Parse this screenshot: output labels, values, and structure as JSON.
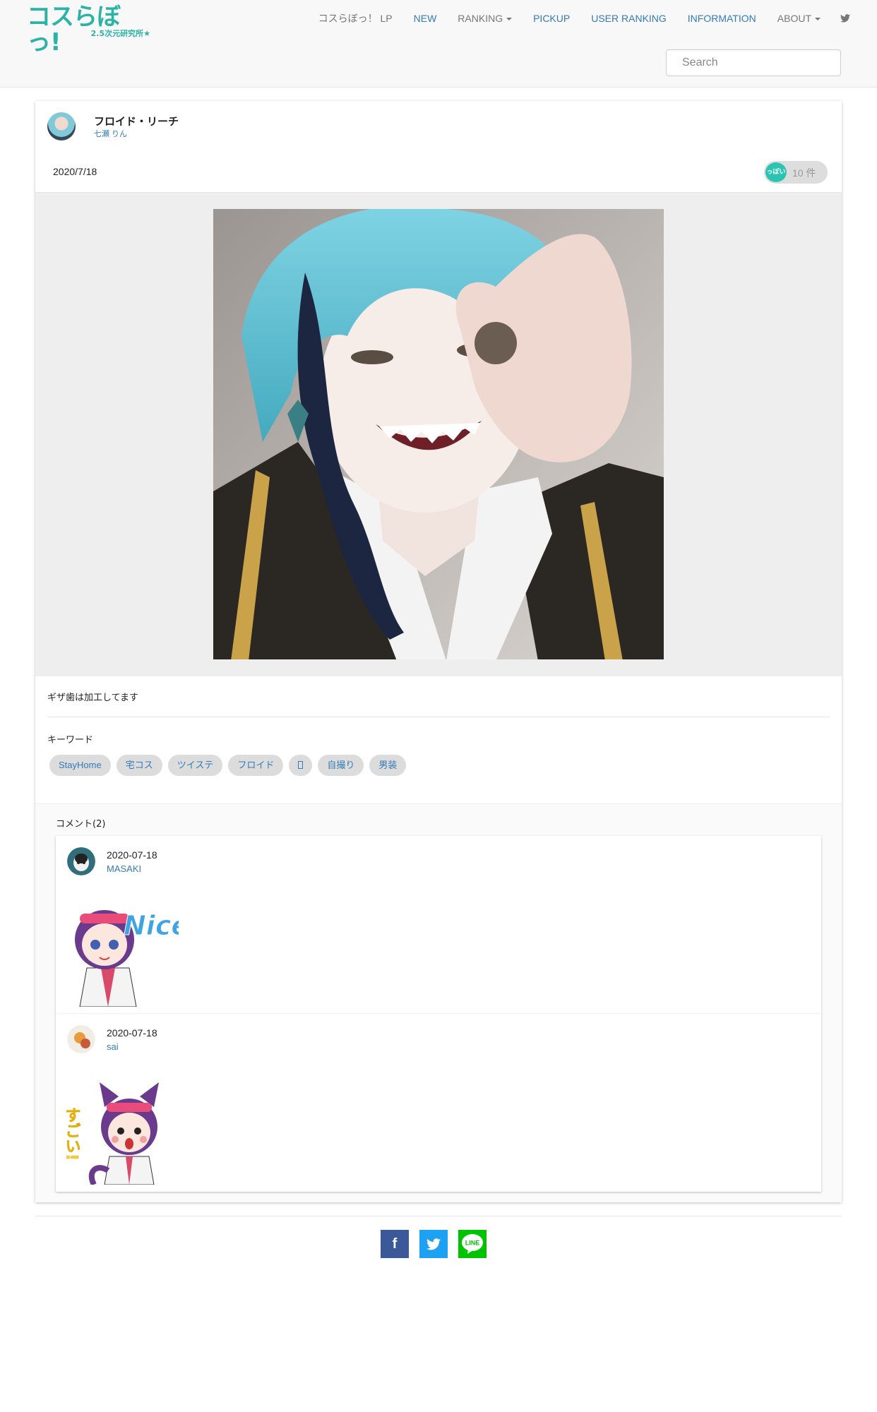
{
  "nav": {
    "logo_text": "コスらぼっ!",
    "logo_sub": "2.5次元研究所★",
    "items": [
      {
        "label": "コスらぼっ！ LP",
        "style": "gray",
        "dropdown": false
      },
      {
        "label": "NEW",
        "style": "blue",
        "dropdown": false
      },
      {
        "label": "RANKING",
        "style": "gray",
        "dropdown": true
      },
      {
        "label": "PICKUP",
        "style": "blue",
        "dropdown": false
      },
      {
        "label": "USER RANKING",
        "style": "blue",
        "dropdown": false
      },
      {
        "label": "INFORMATION",
        "style": "blue",
        "dropdown": false
      },
      {
        "label": "ABOUT",
        "style": "gray",
        "dropdown": true
      }
    ],
    "search_placeholder": "Search"
  },
  "post": {
    "title": "フロイド・リーチ",
    "author": "七瀬 りん",
    "date": "2020/7/18",
    "like_icon_label": "っぽい",
    "like_count": "10 件",
    "caption": "ギザ歯は加工してます",
    "keywords_title": "キーワード",
    "tags": [
      "StayHome",
      "宅コス",
      "ツイステ",
      "フロイド",
      "",
      "自撮り",
      "男装"
    ]
  },
  "comments": {
    "title": "コメント(2)",
    "items": [
      {
        "date": "2020-07-18",
        "user": "MASAKI",
        "sticker_text": "Nice"
      },
      {
        "date": "2020-07-18",
        "user": "sai",
        "sticker_text": "すごい!"
      }
    ]
  },
  "share": {
    "facebook_icon": "f",
    "line_label": "LINE"
  },
  "colors": {
    "brand": "#2bb3a6",
    "link": "#337ab7",
    "facebook": "#3b5998",
    "twitter": "#1da1f2",
    "line": "#00c300"
  }
}
